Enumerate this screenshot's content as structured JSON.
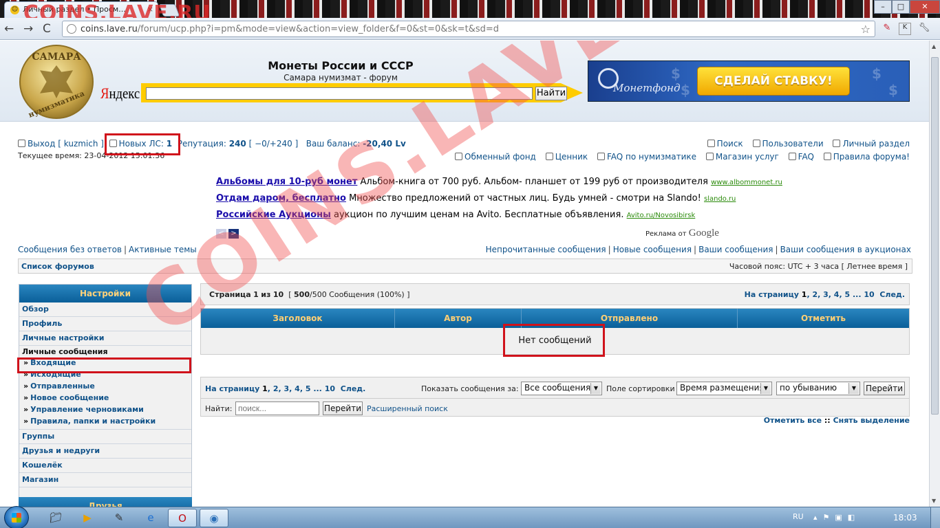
{
  "browser": {
    "tab_title": "Личный раздел • Просм...",
    "tab_close": "×",
    "url_host": "coins.lave.ru",
    "url_path": "/forum/ucp.php?i=pm&mode=view&action=view_folder&f=0&st=0&sk=t&sd=d",
    "back": "←",
    "forward": "→",
    "reload": "C",
    "star": "☆",
    "minimize": "–",
    "maximize": "□",
    "close": "✕"
  },
  "header": {
    "logo_top": "САМАРА",
    "logo_bottom": "нумизматика",
    "site_title": "Монеты России и СССР",
    "site_subtitle": "Самара нумизмат - форум",
    "yandex_logo_first": "Я",
    "yandex_logo_rest": "ндекс",
    "yandex_button": "Найти",
    "banner_brand": "Монетфонд",
    "banner_button": "СДЕЛАЙ СТАВКУ!"
  },
  "userbar": {
    "logout": "Выход [ kuzmich ]",
    "new_pm_label": "Новых ЛС:",
    "new_pm_count": "1",
    "reputation_label": "Репутация:",
    "reputation_value": "240",
    "reputation_detail": "[ −0/+240 ]",
    "balance_label": "Ваш баланс:",
    "balance_value": "-20,40 Lv",
    "current_time": "Текущее время: 23-04-2012 15:01:36"
  },
  "quicklinks": {
    "search": "Поиск",
    "users": "Пользователи",
    "ucp": "Личный раздел",
    "exchange": "Обменный фонд",
    "prices": "Ценник",
    "faq_numis": "FAQ по нумизматике",
    "shop": "Магазин услуг",
    "faq": "FAQ",
    "rules": "Правила форума!"
  },
  "ads": [
    {
      "title": "Альбомы для 10-руб монет",
      "text": "Альбом-книга от 700 руб. Альбом- планшет от 199 руб от производителя",
      "url": "www.albommonet.ru"
    },
    {
      "title": "Отдам даром, бесплатно",
      "text": "Множество предложений от частных лиц. Будь умней - смотри на Slando!",
      "url": "slando.ru"
    },
    {
      "title": "Российские Аукционы",
      "text": "аукцион по лучшим ценам на Avito. Бесплатные объявления.",
      "url": "Avito.ru/Novosibirsk"
    }
  ],
  "ads_footer": {
    "prefix": "Реклама от",
    "brand": "Google",
    "prev": "<",
    "next": ">"
  },
  "navline": {
    "unanswered": "Сообщения без ответов",
    "active": "Активные темы",
    "unread": "Непрочитанные сообщения",
    "new": "Новые сообщения",
    "yours": "Ваши сообщения",
    "auctions": "Ваши сообщения в аукционах",
    "breadcrumb": "Список форумов",
    "timezone": "Часовой пояс: UTC + 3 часа [ Летнее время ]"
  },
  "sidebar": {
    "heading": "Настройки",
    "items_top": [
      "Обзор",
      "Профиль",
      "Личные настройки"
    ],
    "pm_heading": "Личные сообщения",
    "pm_items": [
      "Входящие",
      "Исходящие",
      "Отправленные",
      "Новое сообщение",
      "Управление черновиками",
      "Правила, папки и настройки"
    ],
    "items_bottom": [
      "Группы",
      "Друзья и недруги",
      "Кошелёк",
      "Магазин"
    ],
    "heading2": "Друзья"
  },
  "main": {
    "page_label": "Страница",
    "page_current": "1",
    "page_of": "из",
    "page_total": "10",
    "count_bold": "500",
    "count_rest": "/500 Сообщения (100%) ]",
    "count_open": "[",
    "pagination_label": "На страницу",
    "pages": [
      "1",
      "2",
      "3",
      "4",
      "5"
    ],
    "ellipsis": "...",
    "last_page": "10",
    "next": "След.",
    "columns": [
      "Заголовок",
      "Автор",
      "Отправлено",
      "Отметить"
    ],
    "empty": "Нет сообщений",
    "show_label": "Показать сообщения за:",
    "show_value": "Все сообщения",
    "sort_label": "Поле сортировки",
    "sort_value": "Время размещения",
    "order_value": "по убыванию",
    "go": "Перейти",
    "find_label": "Найти:",
    "find_placeholder": "поиск...",
    "advanced": "Расширенный поиск",
    "mark_all": "Отметить все",
    "mark_sep": "::",
    "unmark": "Снять выделение"
  },
  "watermark": {
    "top": "COINS.LAVE.RU",
    "diagonal": "COINS.LAVE.RU"
  },
  "taskbar": {
    "lang": "RU",
    "clock": "18:03"
  },
  "colors": {
    "link": "#105289",
    "highlight_red": "#d0121b",
    "table_head": "#0a5f99",
    "table_head_text": "#ffcf74"
  }
}
